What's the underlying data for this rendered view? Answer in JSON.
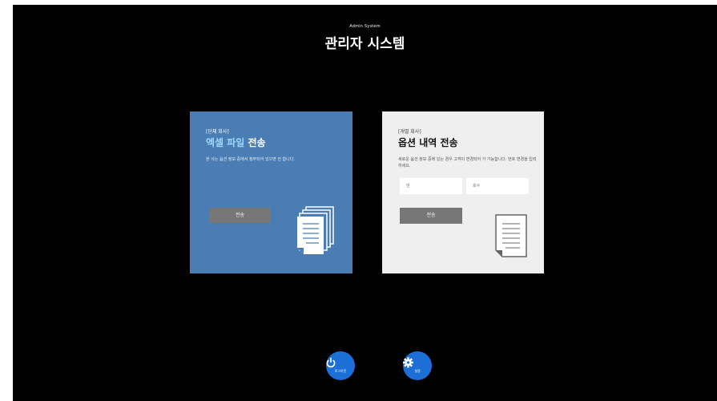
{
  "header": {
    "subtitle": "Admin System",
    "title": "관리자 시스템"
  },
  "cards": {
    "excel": {
      "tag": "[단체 회사]",
      "title_highlight": "엑셀 파일",
      "title_rest": " 전송",
      "description": "본 사는 옵션 정보 중에서 첨부되어 있으면 전 합니다.",
      "button_label": "전송",
      "icon": "document-stack-icon"
    },
    "option": {
      "tag": "[개별 회사]",
      "title": "옵션 내역 전송",
      "description": "새로운 옵션 정보 중에 있는 경우 고객이 변경되어 가 가능합니다. 번호 변경을 입력하세요.",
      "input1_placeholder": "번",
      "input2_placeholder": "호수",
      "button_label": "전송",
      "icon": "document-icon"
    }
  },
  "footer": {
    "logout_label": "로그아웃",
    "logout_icon": "power-icon",
    "settings_label": "설정",
    "settings_icon": "gear-icon"
  },
  "colors": {
    "background": "#000000",
    "excel_card": "#4a7db4",
    "option_card": "#efefef",
    "button_gray": "#777777",
    "circle_blue": "#1b6fd6"
  }
}
